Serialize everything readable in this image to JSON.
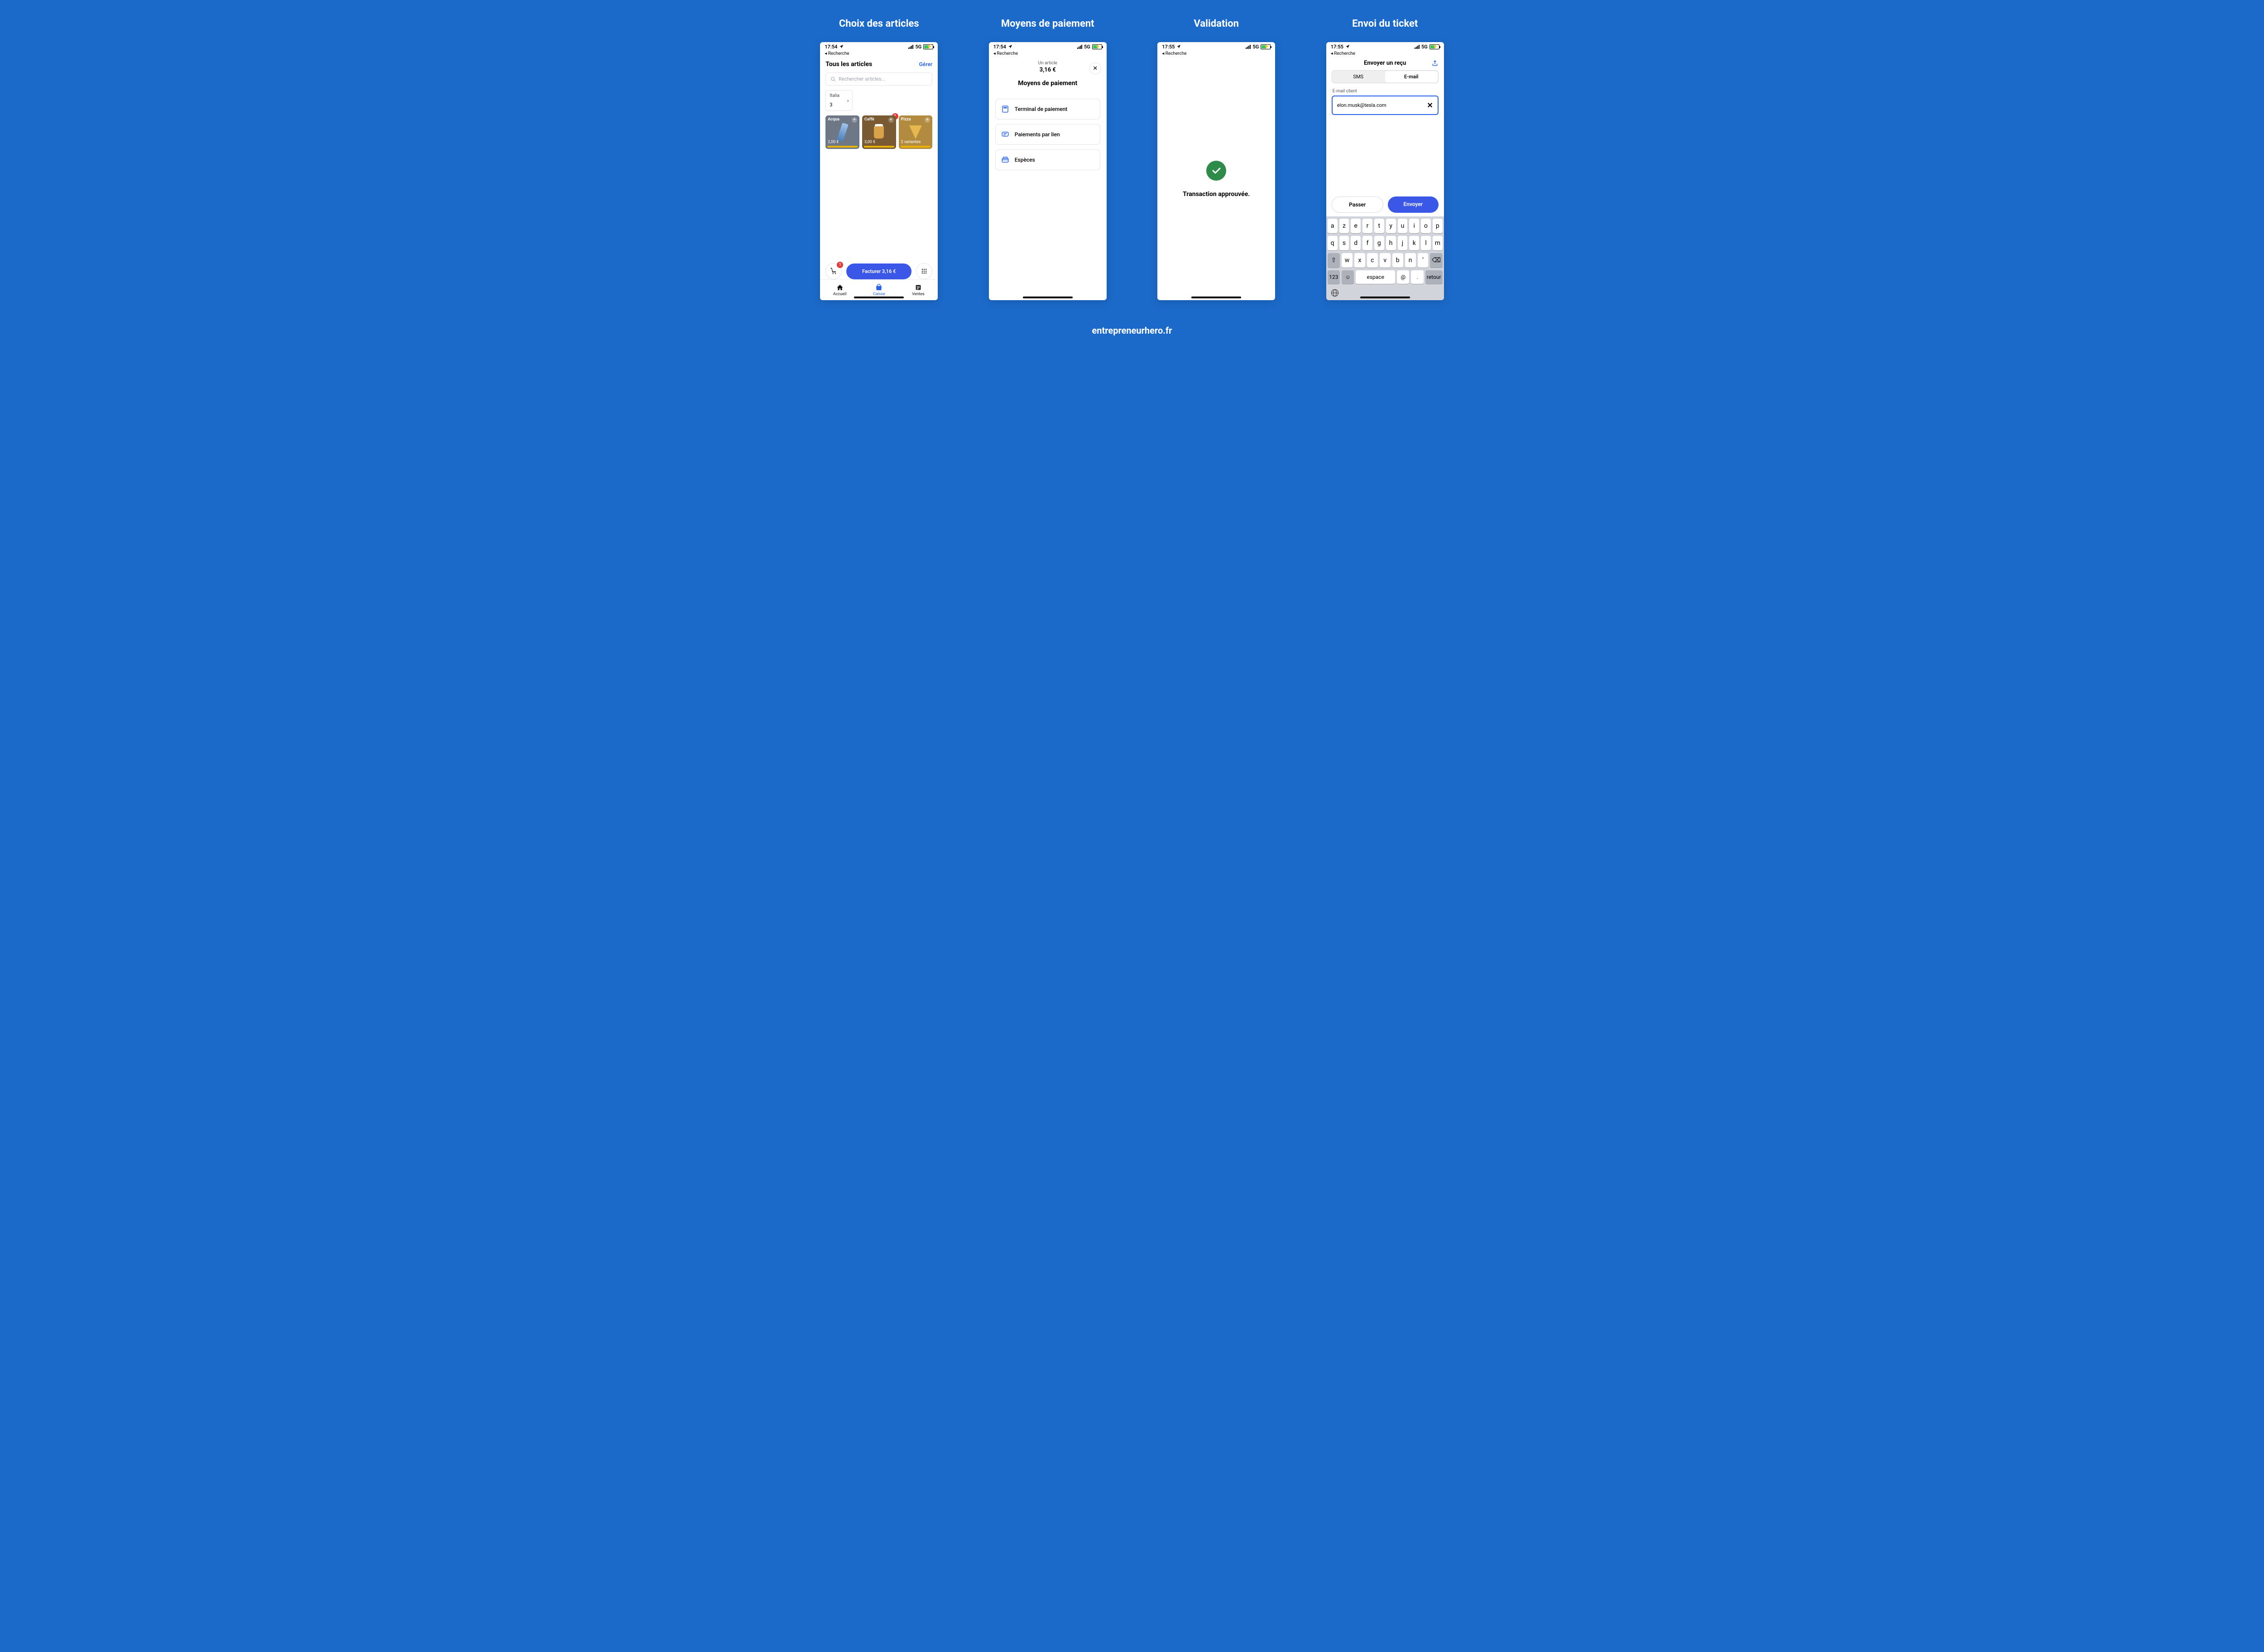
{
  "titles": {
    "col1": "Choix des articles",
    "col2": "Moyens de paiement",
    "col3": "Validation",
    "col4": "Envoi du ticket"
  },
  "footer": "entrepreneurhero.fr",
  "status": {
    "time1": "17:54",
    "time2": "17:54",
    "time3": "17:55",
    "time4": "17:55",
    "network": "5G",
    "back": "Recherche"
  },
  "screen1": {
    "header": "Tous les articles",
    "manage": "Gérer",
    "search_placeholder": "Rechercher articles...",
    "filter_label": "Italia",
    "filter_count": "3",
    "products": [
      {
        "name": "Acqua",
        "price": "2,00 €"
      },
      {
        "name": "Caffè",
        "price": "3,00 €",
        "badge": "1"
      },
      {
        "name": "Pizza",
        "price": "2 variantes"
      }
    ],
    "cart_badge": "1",
    "bill_button": "Facturer 3,16 €",
    "tabs": {
      "home": "Accueil",
      "register": "Caisse",
      "sales": "Ventes"
    }
  },
  "screen2": {
    "item_count": "Un article",
    "amount": "3,16 €",
    "title": "Moyens de paiement",
    "options": {
      "terminal": "Terminal de paiement",
      "link": "Paiements par lien",
      "cash": "Espèces"
    }
  },
  "screen3": {
    "message": "Transaction approuvée."
  },
  "screen4": {
    "title": "Envoyer un reçu",
    "seg_sms": "SMS",
    "seg_email": "E-mail",
    "field_label": "E-mail client",
    "email_value": "elon.musk@tesla.com",
    "skip": "Passer",
    "send": "Envoyer",
    "keys_row1": [
      "a",
      "z",
      "e",
      "r",
      "t",
      "y",
      "u",
      "i",
      "o",
      "p"
    ],
    "keys_row2": [
      "q",
      "s",
      "d",
      "f",
      "g",
      "h",
      "j",
      "k",
      "l",
      "m"
    ],
    "keys_row3": [
      "w",
      "x",
      "c",
      "v",
      "b",
      "n",
      "’"
    ],
    "key_shift": "⇧",
    "key_backspace": "⌫",
    "key_123": "123",
    "key_emoji": "☺",
    "key_space": "espace",
    "key_at": "@",
    "key_dot": ".",
    "key_return": "retour"
  }
}
